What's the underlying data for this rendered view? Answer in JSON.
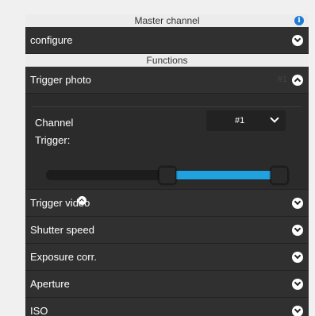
{
  "master": {
    "header": "Master channel",
    "info_icon": "info-icon",
    "configure_label": "configure"
  },
  "functions": {
    "header": "Functions",
    "trigger_photo": {
      "label": "Trigger photo",
      "channel_tag": "#1",
      "channel_label": "Channel",
      "channel_value": "#1",
      "trigger_label": "Trigger:",
      "slider": {
        "range_start": 0.5,
        "range_end": 0.95,
        "fill_color": "#21a1dd"
      }
    },
    "items": [
      {
        "label": "Trigger video"
      },
      {
        "label": "Shutter speed"
      },
      {
        "label": "Exposure corr."
      },
      {
        "label": "Aperture"
      },
      {
        "label": "ISO"
      }
    ]
  }
}
